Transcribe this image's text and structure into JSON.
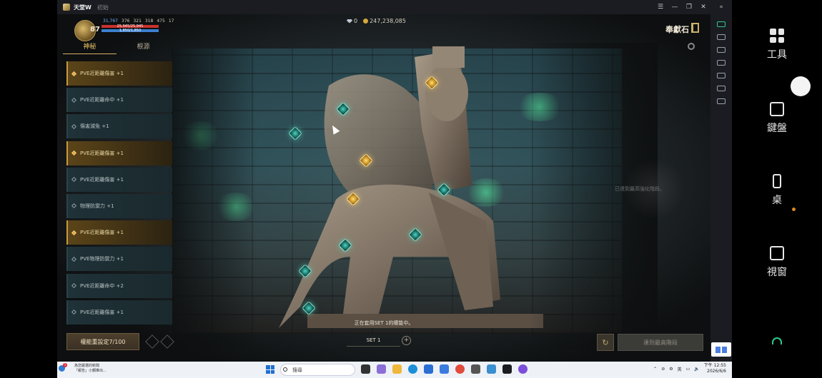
{
  "window": {
    "app_name": "天堂W",
    "status": "初始",
    "controls": [
      "☰",
      "—",
      "❐",
      "✕"
    ],
    "collapse": "«"
  },
  "hud": {
    "level": "87",
    "combat_power": "31,767",
    "stats": [
      "376",
      "321",
      "318",
      "475",
      "17"
    ],
    "hp_text": "25,945/25,945",
    "mp_text": "1,850/1,850",
    "hp_fill": 1.0,
    "mp_fill": 1.0,
    "gems": "0",
    "gold": "247,238,085",
    "page_title": "奉獻石"
  },
  "tabs": [
    {
      "label": "神秘",
      "active": true
    },
    {
      "label": "根源",
      "active": false
    }
  ],
  "list": [
    {
      "label": "PVE近距離傷害 +1",
      "highlight": true
    },
    {
      "label": "PVE近距離命中 +1",
      "highlight": false
    },
    {
      "label": "傷害減免 +1",
      "highlight": false
    },
    {
      "label": "PVE近距離傷害 +1",
      "highlight": true
    },
    {
      "label": "PVE近距離傷害 +1",
      "highlight": false
    },
    {
      "label": "物理防禦力 +1",
      "highlight": false
    },
    {
      "label": "PVE近距離傷害 +1",
      "highlight": true
    },
    {
      "label": "PVE物理防禦力 +1",
      "highlight": false
    },
    {
      "label": "PVE近距離命中 +2",
      "highlight": false
    },
    {
      "label": "PVE近距離傷害 +1",
      "highlight": false
    }
  ],
  "bottom": {
    "reset_label": "權能重設定7/100",
    "status_message": "正在套用SET 1的權能中。",
    "set_label": "SET 1",
    "add": "+",
    "refresh": "↻",
    "max_button": "達到最高階段",
    "max_note": "已達到最高強化階段。"
  },
  "emulator_panel": {
    "tools": "工具",
    "keyboard": "鍵盤",
    "desktop": "桌",
    "window": "視窗"
  },
  "taskbar": {
    "news_title": "為您嚴選的新聞",
    "news_sub": "「報告」小鋼推出...",
    "search_placeholder": "搜尋",
    "lang": "英",
    "time": "下午 12:55",
    "date": "2026/6/6"
  },
  "colors": {
    "accent_gold": "#f0c56a",
    "node_green": "#4fd2c0",
    "node_gold": "#ffe07a",
    "emulator_green": "#2ec98a"
  }
}
